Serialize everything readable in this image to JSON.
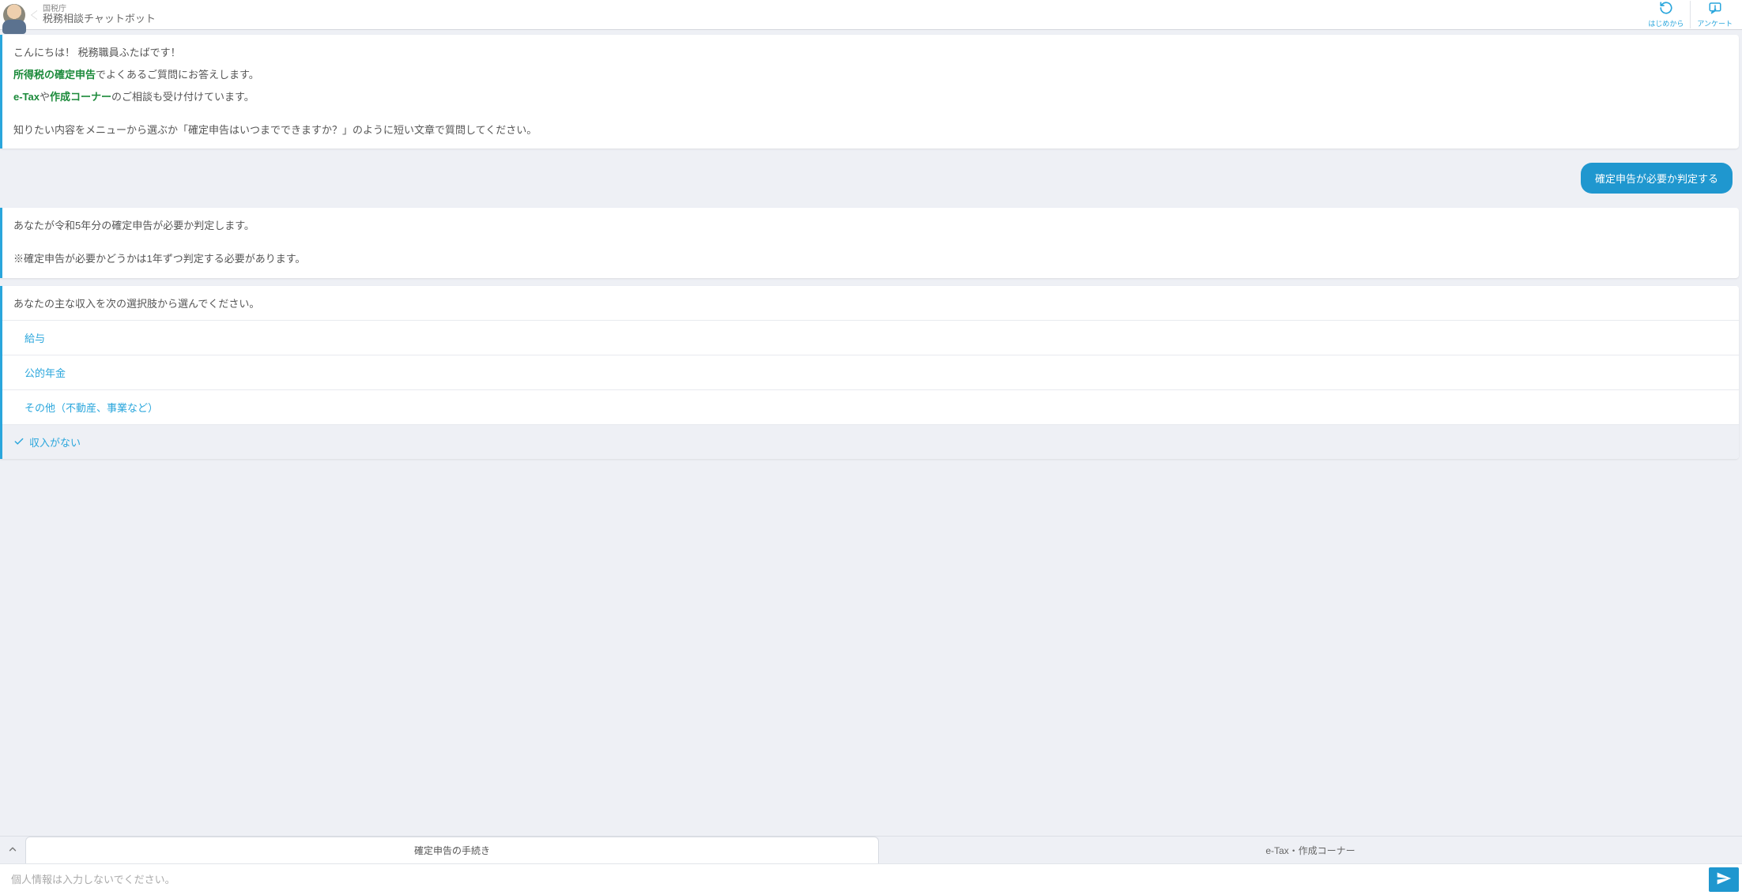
{
  "header": {
    "org": "国税庁",
    "title": "税務相談チャットボット",
    "restart_label": "はじめから",
    "survey_label": "アンケート"
  },
  "welcome": {
    "line1": "こんにちは！ 税務職員ふたばです！",
    "line2_strong": "所得税の確定申告",
    "line2_rest": "でよくあるご質問にお答えします。",
    "line3_a": "e-Tax",
    "line3_mid": "や",
    "line3_b": "作成コーナー",
    "line3_rest": "のご相談も受け付けています。",
    "line4": "知りたい内容をメニューから選ぶか「確定申告はいつまでできますか？」のように短い文章で質問してください。"
  },
  "user_msg": "確定申告が必要か判定する",
  "followup": {
    "p1": "あなたが令和5年分の確定申告が必要か判定します。",
    "p2": "※確定申告が必要かどうかは1年ずつ判定する必要があります。"
  },
  "options": {
    "header": "あなたの主な収入を次の選択肢から選んでください。",
    "items": [
      {
        "label": "給与",
        "selected": false
      },
      {
        "label": "公的年金",
        "selected": false
      },
      {
        "label": "その他（不動産、事業など）",
        "selected": false
      },
      {
        "label": "収入がない",
        "selected": true
      }
    ]
  },
  "tabs": {
    "a": "確定申告の手続き",
    "b": "e-Tax・作成コーナー"
  },
  "input": {
    "placeholder": "個人情報は入力しないでください。"
  }
}
